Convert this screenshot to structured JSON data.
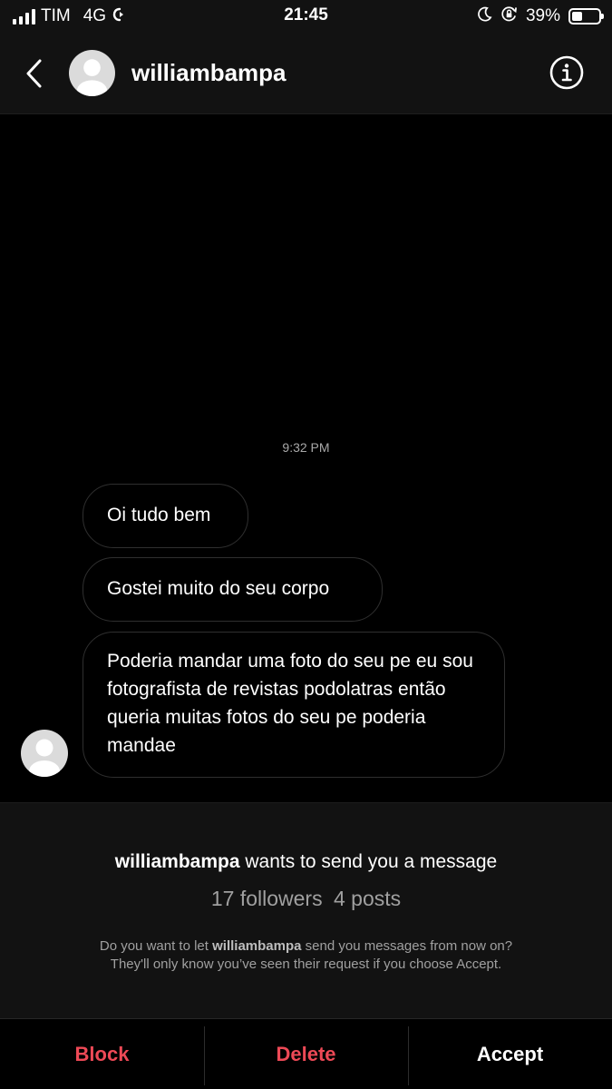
{
  "status_bar": {
    "carrier": "TIM",
    "network": "4G",
    "time": "21:45",
    "battery_percent": "39%",
    "battery_level": 0.39,
    "icons": [
      "signal-icon",
      "call-forward-icon",
      "moon-icon",
      "rotation-lock-icon",
      "battery-icon"
    ]
  },
  "header": {
    "username": "williambampa",
    "icons": [
      "back-chevron-icon",
      "avatar-icon",
      "info-icon"
    ]
  },
  "conversation": {
    "timestamp": "9:32 PM",
    "messages": [
      {
        "text": "Oi tudo bem"
      },
      {
        "text": "Gostei muito do seu corpo"
      },
      {
        "text": "Poderia mandar uma foto do seu pe eu sou fotografista de revistas podolatras então queria muitas fotos do seu pe poderia mandae"
      }
    ]
  },
  "request": {
    "username": "williambampa",
    "title_suffix": " wants to send you a message",
    "followers": "17 followers",
    "posts": "4 posts",
    "desc_prefix": "Do you want to let ",
    "desc_username": "williambampa",
    "desc_suffix": " send you messages from now on?",
    "desc_line2": "They'll only know you’ve seen their request if you choose Accept."
  },
  "actions": {
    "block": "Block",
    "delete": "Delete",
    "accept": "Accept"
  },
  "colors": {
    "background": "#000000",
    "panel": "#121212",
    "bubble_border": "#2f2f2f",
    "danger": "#ed4956",
    "muted_text": "#a0a0a0"
  }
}
